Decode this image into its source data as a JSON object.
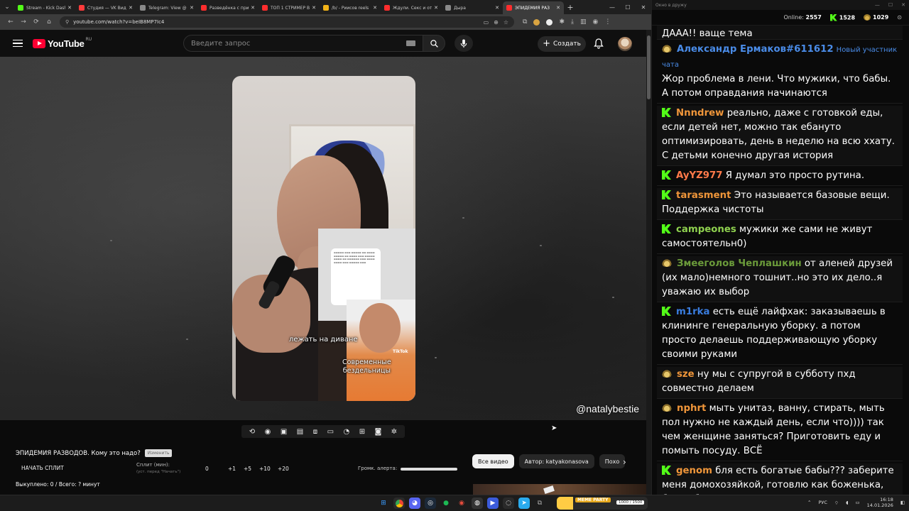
{
  "browser": {
    "tabs": [
      {
        "title": "Stream - Kick Dashboard",
        "color": "#53fc18"
      },
      {
        "title": "Студия — VK Видео",
        "color": "#ff3b3b"
      },
      {
        "title": "Telegram: View @",
        "color": "#8a8a8a"
      },
      {
        "title": "Разведёнка с прице",
        "color": "#ff2d2d"
      },
      {
        "title": "ТОП 1 СТРИМЕР ВС",
        "color": "#ff2d2d"
      },
      {
        "title": "/b/ - Риисов reels",
        "color": "#f2b318"
      },
      {
        "title": "Ждули. Секс и отн",
        "color": "#ff2d2d"
      },
      {
        "title": "Дыра",
        "color": "#8a8a8a"
      },
      {
        "title": "ЭПИДЕМИЯ РАЗ",
        "color": "#ff2d2d",
        "active": true
      }
    ],
    "new_tab": "+",
    "url": "youtube.com/watch?v=beIB8MP7Ic4"
  },
  "youtube": {
    "logo_text": "YouTube",
    "region": "RU",
    "search_placeholder": "Введите запрос",
    "create_label": "Создать"
  },
  "video": {
    "caption_top": "лежать на диване",
    "caption_bottom_1": "Современные",
    "caption_bottom_2": "бездельницы",
    "tiktok": "TikTok",
    "handle": "@natalybestie"
  },
  "below": {
    "title": "ЭПИДЕМИЯ РАЗВОДОВ. Кому это надо?",
    "badge": "Изменить",
    "split_button": "НАЧАТЬ СПЛИТ",
    "split_label": "Сплит (мин):",
    "split_sub": "(уст. перед \"Начать\")",
    "split_value": "0",
    "increments": [
      "+1",
      "+5",
      "+10",
      "+20"
    ],
    "bought": "Выкуплено: 0 / Всего: ? минут",
    "alert_volume_label": "Громк. алерта:",
    "chips": [
      {
        "label": "Все видео",
        "active": true
      },
      {
        "label": "Автор: katyakonasova",
        "active": false
      },
      {
        "label": "Похо",
        "active": false
      }
    ]
  },
  "chat": {
    "window_title": "Окно в дружу",
    "online_label": "Online:",
    "online_count": "2557",
    "kick_count": "1528",
    "yt_count": "1029",
    "messages": [
      {
        "platform": "none",
        "nick": "",
        "nick_color": "#ffffff",
        "text": "ДААА!! ваще тема",
        "partial": true
      },
      {
        "platform": "twitch",
        "nick": "Александр Ермаков#611612",
        "nick_color": "#4a8ce8",
        "badge": "Новый участник чата",
        "text": "Жор проблема в лени. Что мужики, что бабы. А потом оправдания начинаются"
      },
      {
        "platform": "kick",
        "nick": "Nnndrew",
        "nick_color": "#f0963a",
        "text": "реально, даже с готовкой еды, если детей нет, можно так ебануто оптимизировать, день в неделю на всю ххату. С детьми конечно другая история"
      },
      {
        "platform": "kick",
        "nick": "AyYZ977",
        "nick_color": "#ff7a4a",
        "text": "Я думал это просто рутина."
      },
      {
        "platform": "kick",
        "nick": "tarasment",
        "nick_color": "#f0963a",
        "text": "Это называется базовые вещи. Поддержка чистоты"
      },
      {
        "platform": "kick",
        "nick": "campeones",
        "nick_color": "#8fd14f",
        "text": "мужики же сами не живут самостоятельн0)"
      },
      {
        "platform": "twitch",
        "nick": "Змееголов Чеплашкин",
        "nick_color": "#6b9b3a",
        "text": "от аленей друзей (их мало)немного тошнит..но это их дело..я уважаю их выбор"
      },
      {
        "platform": "kick",
        "nick": "m1rka",
        "nick_color": "#3a7de0",
        "text": "есть ещё лайфхак: заказываешь в клининге генеральную уборку. а потом просто делаешь поддерживающую уборку своими руками"
      },
      {
        "platform": "twitch",
        "nick": "sze",
        "nick_color": "#f0963a",
        "text": "ну мы с супругой в субботу пхд совместно делаем"
      },
      {
        "platform": "twitch",
        "nick": "nphrt",
        "nick_color": "#f0963a",
        "text": "мыть унитаз, ванну, стирать, мыть пол нужно не каждый день, если что)))) так чем женщине заняться? Приготовить еду и помыть посуду. ВСЁ"
      },
      {
        "platform": "kick",
        "nick": "genom",
        "nick_color": "#f0963a",
        "text": "бля есть богатые бабы??? заберите меня домохозяйкой, готовлю как боженька, буду убирать и с детьми сидеть"
      }
    ]
  },
  "taskbar": {
    "widget_label": "MEME PARTY",
    "widget_count": "1000 / 1500",
    "lang": "РУС",
    "time": "16:18",
    "date": "14.01.2026"
  }
}
